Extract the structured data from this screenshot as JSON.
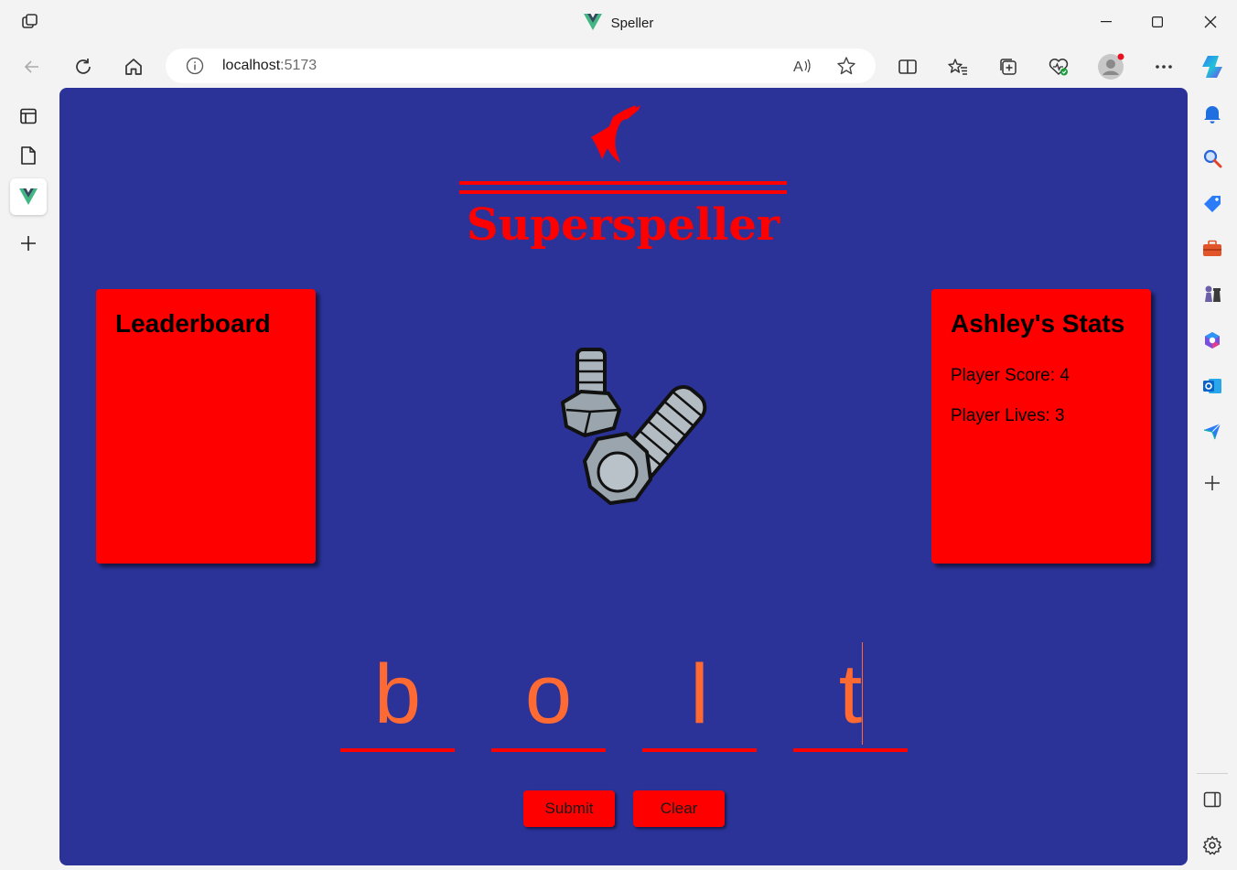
{
  "window": {
    "title": "Speller"
  },
  "address_bar": {
    "host": "localhost",
    "port": ":5173"
  },
  "app": {
    "logo_text": "Superspeller",
    "leaderboard": {
      "title": "Leaderboard"
    },
    "stats": {
      "title": "Ashley's Stats",
      "score_label": "Player Score: 4",
      "lives_label": "Player Lives: 3"
    },
    "letters": [
      "b",
      "o",
      "l",
      "t"
    ],
    "buttons": {
      "submit": "Submit",
      "clear": "Clear"
    }
  },
  "colors": {
    "background": "#2b3399",
    "panel": "#ff0000",
    "letter": "#ff6a33",
    "underline": "#ff0000"
  }
}
